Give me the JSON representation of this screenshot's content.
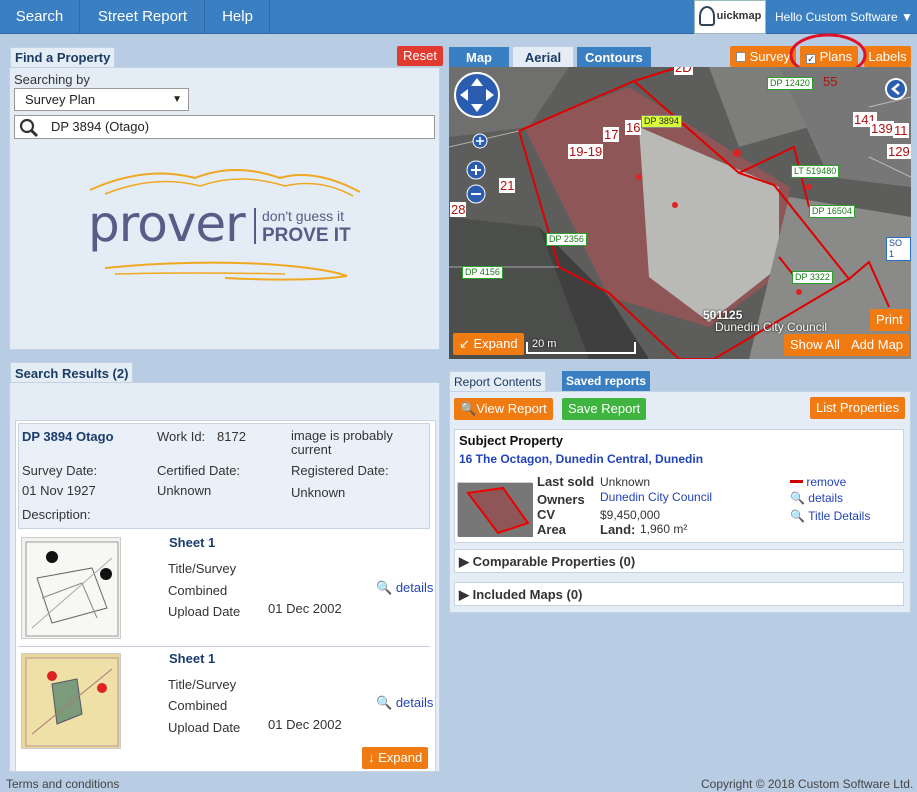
{
  "nav": {
    "search": "Search",
    "street_report": "Street Report",
    "help": "Help",
    "brand": "uickmap",
    "user": "Hello Custom Software ▼"
  },
  "find": {
    "tab": "Find a Property",
    "reset": "Reset",
    "searching_by": "Searching by",
    "search_type": "Survey Plan",
    "query": "DP 3894 (Otago)",
    "prover": {
      "word": "prover",
      "tag1": "don't guess it",
      "tag2": "PROVE IT"
    }
  },
  "results": {
    "tab": "Search Results (2)",
    "record": {
      "title": "DP 3894 Otago",
      "work_id_label": "Work Id:",
      "work_id": "8172",
      "image_status": "image is probably current",
      "survey_date_label": "Survey Date:",
      "survey_date": "01 Nov 1927",
      "certified_label": "Certified Date:",
      "certified": "Unknown",
      "registered_label": "Registered Date:",
      "registered": "Unknown",
      "description_label": "Description:"
    },
    "sheets": [
      {
        "name": "Sheet 1",
        "type": "Title/Survey",
        "kind": "Combined",
        "upload_label": "Upload Date",
        "upload": "01 Dec 2002",
        "details": "details"
      },
      {
        "name": "Sheet 1",
        "type": "Title/Survey",
        "kind": "Combined",
        "upload_label": "Upload Date",
        "upload": "01 Dec 2002",
        "details": "details"
      }
    ],
    "expand": "↓ Expand"
  },
  "map": {
    "tabs": [
      "Map",
      "Aerial",
      "Contours"
    ],
    "survey": "Survey",
    "plans": "Plans",
    "labels": "Labels",
    "expand": "↙ Expand",
    "print": "Print",
    "show_all": "Show All",
    "add_map": "Add Map",
    "scale": "20 m",
    "parcel_id": "501125",
    "owner": "Dunedin City Council",
    "dp_labels": [
      "DP 3894",
      "DP 12420",
      "LT 519480",
      "DP 16504",
      "DP 2356",
      "DP 4156",
      "DP 3322",
      "SO 1"
    ],
    "road_numbers": [
      "17",
      "16",
      "19-19",
      "21",
      "28",
      "141",
      "139",
      "11",
      "129",
      "55",
      "2D"
    ]
  },
  "report": {
    "tab_contents": "Report Contents",
    "tab_saved": "Saved reports",
    "view": "View Report",
    "save": "Save Report",
    "list": "List Properties",
    "subject_title": "Subject Property",
    "address": "16 The Octagon, Dunedin Central, Dunedin",
    "last_sold_label": "Last sold",
    "last_sold": "Unknown",
    "owners_label": "Owners",
    "owners": "Dunedin City Council",
    "cv_label": "CV",
    "cv": "$9,450,000",
    "area_label": "Area",
    "land_label": "Land:",
    "land": "1,960 m²",
    "remove": "remove",
    "details": "details",
    "title_details": "Title Details",
    "comparable": "Comparable Properties (0)",
    "included_maps": "Included Maps (0)"
  },
  "footer": {
    "terms": "Terms and conditions",
    "copyright": "Copyright © 2018 Custom Software Ltd."
  },
  "colors": {
    "topbar": "#3a7fc2",
    "accent_orange": "#f07b12",
    "accent_green": "#3fb53f",
    "reset_red": "#e23a2e",
    "parcel_red": "#e00000"
  }
}
